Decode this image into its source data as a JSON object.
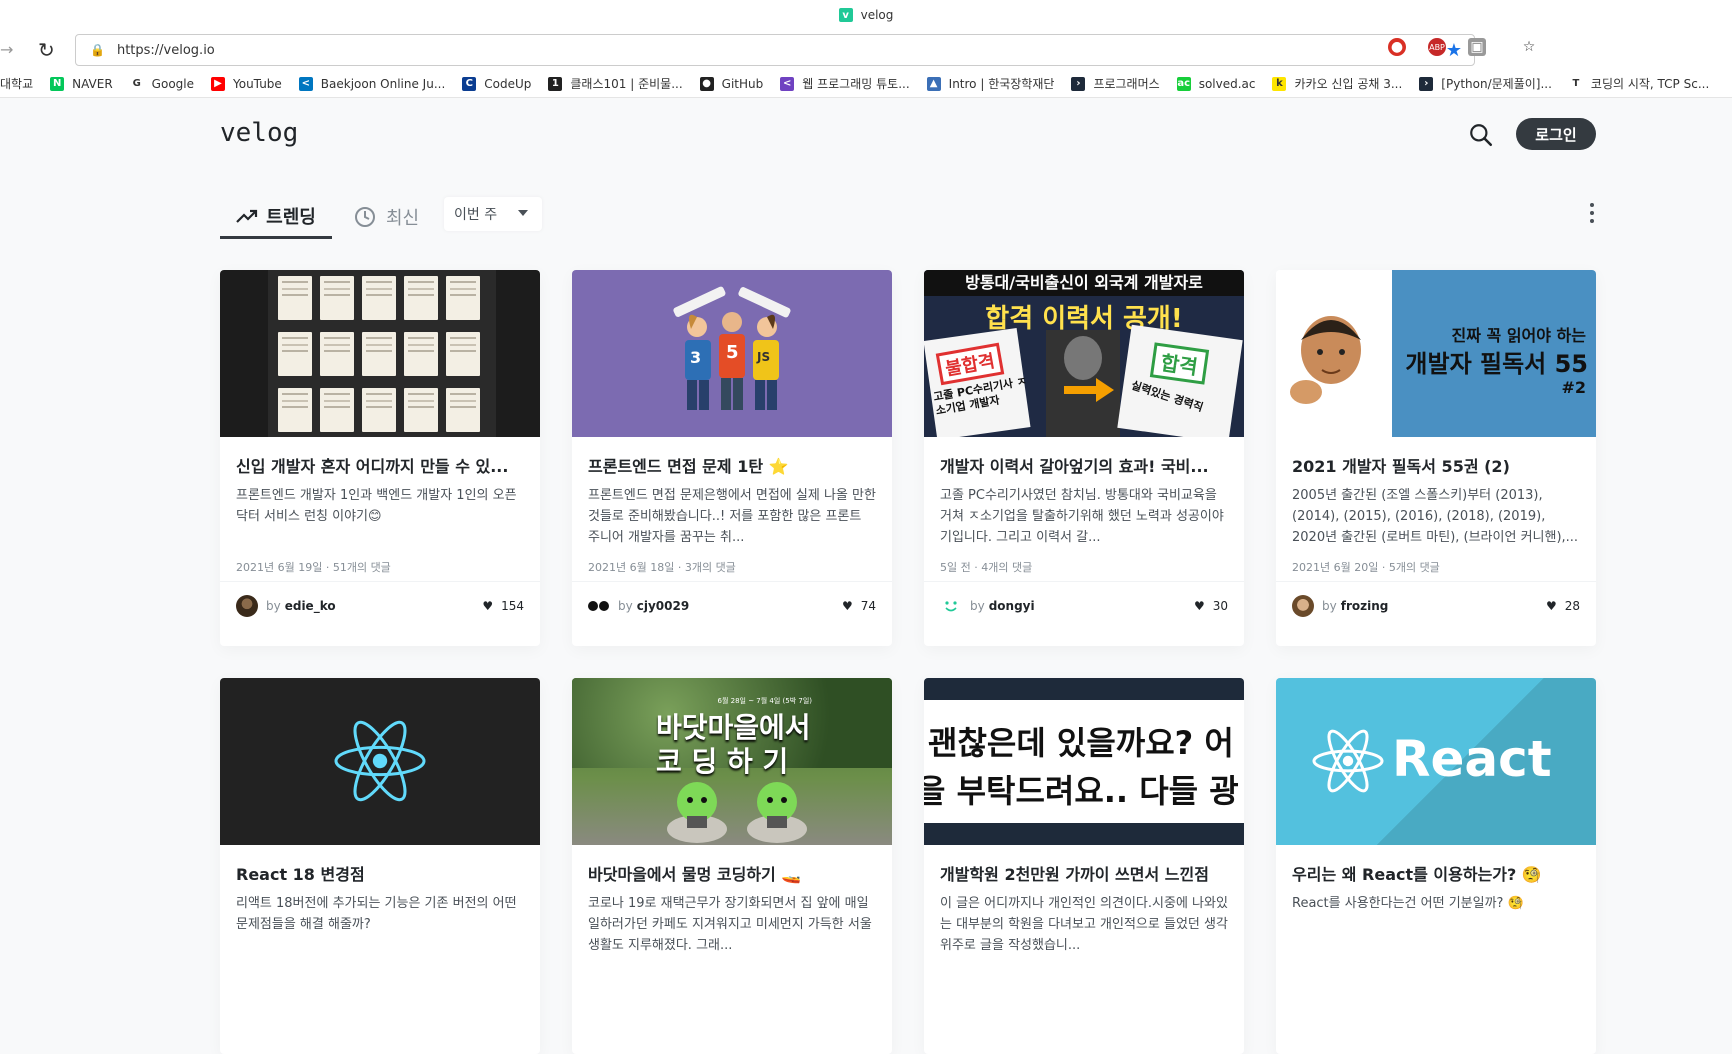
{
  "browser": {
    "tab_title": "velog",
    "url": "https://velog.io",
    "bookmarks": [
      {
        "label": "대학교",
        "icon": "none"
      },
      {
        "label": "NAVER",
        "icon": "naver-icon",
        "color": "#03c75a",
        "glyph": "N"
      },
      {
        "label": "Google",
        "icon": "google-icon",
        "color": "#ffffff",
        "glyph": "G"
      },
      {
        "label": "YouTube",
        "icon": "youtube-icon",
        "color": "#ff0000",
        "glyph": "▶"
      },
      {
        "label": "Baekjoon Online Ju...",
        "icon": "code-icon",
        "color": "#0076c0",
        "glyph": "<"
      },
      {
        "label": "CodeUp",
        "icon": "codeup-icon",
        "color": "#0b3d91",
        "glyph": "C"
      },
      {
        "label": "클래스101 | 준비물...",
        "icon": "class101-icon",
        "color": "#222222",
        "glyph": "1"
      },
      {
        "label": "GitHub",
        "icon": "github-icon",
        "color": "#222222",
        "glyph": "●"
      },
      {
        "label": "웹 프로그래밍 튜토...",
        "icon": "tutorial-icon",
        "color": "#6f42c1",
        "glyph": "<"
      },
      {
        "label": "Intro | 한국장학재단",
        "icon": "scholarship-icon",
        "color": "#3b6fb6",
        "glyph": "▲"
      },
      {
        "label": "프로그래머스",
        "icon": "programmers-icon",
        "color": "#1e2a3a",
        "glyph": "›"
      },
      {
        "label": "solved.ac",
        "icon": "solvedac-icon",
        "color": "#17ce3a",
        "glyph": "ac"
      },
      {
        "label": "카카오 신입 공채 3...",
        "icon": "kakao-icon",
        "color": "#fee500",
        "glyph": "k"
      },
      {
        "label": "[Python/문제풀이]...",
        "icon": "programmers-icon",
        "color": "#1e2a3a",
        "glyph": "›"
      },
      {
        "label": "코딩의 시작, TCP Sc...",
        "icon": "tcpschool-icon",
        "color": "#ffffff",
        "glyph": "T"
      }
    ]
  },
  "site": {
    "logo": "velog",
    "login_label": "로그인"
  },
  "tabs": {
    "trending": "트렌딩",
    "recent": "최신",
    "period": "이번 주"
  },
  "posts": [
    {
      "title": "신입 개발자 혼자 어디까지 만들 수 있...",
      "desc": "프론트엔드 개발자 1인과 백엔드 개발자 1인의 오픈닥터 서비스 런칭 이야기😊",
      "meta": "2021년 6월 19일 · 51개의 댓글",
      "author": "edie_ko",
      "likes": "154",
      "thumb": "notes"
    },
    {
      "title": "프론트엔드 면접 문제 1탄 ⭐",
      "desc": "프론트엔드 면접 문제은행에서 면접에 실제 나올 만한 것들로 준비해봤습니다..! 저를 포함한 많은 프론트 주니어 개발자를 꿈꾸는 취...",
      "meta": "2021년 6월 18일 · 3개의 댓글",
      "author": "cjy0029",
      "likes": "74",
      "thumb": "web"
    },
    {
      "title": "개발자 이력서 갈아엎기의 효과! 국비...",
      "desc": "고졸 PC수리기사였던 참치님. 방통대와 국비교육을 거쳐 ㅈ소기업을 탈출하기위해 했던 노력과 성공이야기입니다. 그리고 이력서 갈...",
      "meta": "5일 전 · 4개의 댓글",
      "author": "dongyi",
      "likes": "30",
      "thumb": "resume"
    },
    {
      "title": "2021 개발자 필독서 55권 (2)",
      "desc": "2005년 출간된 (조엘 스폴스키)부터 (2013), (2014), (2015), (2016), (2018), (2019), 2020년 출간된 (로버트 마틴), (브라이언 커니핸),...",
      "meta": "2021년 6월 20일 · 5개의 댓글",
      "author": "frozing",
      "likes": "28",
      "thumb": "books"
    },
    {
      "title": "React 18 변경점",
      "desc": "리액트 18버전에 추가되는 기능은 기존 버전의 어떤 문제점들을 해결 해줄까?",
      "meta": "",
      "author": "",
      "likes": "",
      "thumb": "react-dark"
    },
    {
      "title": "바닷마을에서 물멍 코딩하기 🚤",
      "desc": "코로나 19로 재택근무가 장기화되면서 집 앞에 매일 일하러가던 카페도 지겨워지고 미세먼지 가득한 서울 생활도 지루해졌다. 그래...",
      "meta": "",
      "author": "",
      "likes": "",
      "thumb": "sea"
    },
    {
      "title": "개발학원 2천만원 가까이 쓰면서 느낀점",
      "desc": "이 글은 어디까지나 개인적인 의견이다.시중에 나와있는 대부분의 학원을 다녀보고 개인적으로 들었던 생각 위주로 글을 작성했습니...",
      "meta": "",
      "author": "",
      "likes": "",
      "thumb": "subtitle"
    },
    {
      "title": "우리는 왜 React를 이용하는가? 🧐",
      "desc": "React를 사용한다는건 어떤 기분일까? 🧐",
      "meta": "",
      "author": "",
      "likes": "",
      "thumb": "react-blue"
    }
  ],
  "thumb_text": {
    "resume_top": "방통대/국비출신이 외국계 개발자로",
    "resume_main": "합격 이력서 공개!",
    "resume_bad": "불합격",
    "resume_good": "합격",
    "resume_bad_sub": "고졸 PC수리기사 ㅈ소기업 개발자",
    "resume_good_sub": "실력있는 경력직",
    "books_line1": "진짜 꼭 읽어야 하는",
    "books_line2": "개발자 필독서 55",
    "books_line3": "#2",
    "sea_small": "6월 28일 ~ 7월 4일 (5박 7일)",
    "sea_line1": "바닷마을에서",
    "sea_line2": "코 딩 하 기",
    "subtitle_line1": "괜찮은데 있을까요? 어",
    "subtitle_line2": "을 부탁드려요.. 다들 광",
    "react_word": "React",
    "js_badge": "JS",
    "html_badge": "5",
    "css_badge": "3"
  },
  "colors": {
    "brand": "#20c997",
    "login_bg": "#343a40",
    "web_thumb_bg": "#7c6bb1",
    "react_blue": "#61dafb",
    "react_panel": "#53c1de"
  }
}
